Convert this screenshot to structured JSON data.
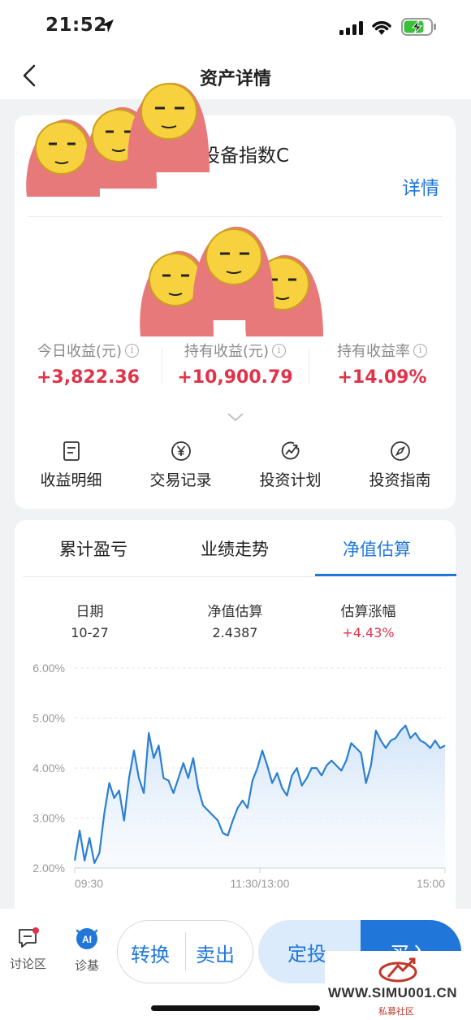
{
  "status_bar": {
    "time": "21:52"
  },
  "nav": {
    "title": "资产详情"
  },
  "fund": {
    "name_visible": "设备指数C",
    "detail_link": "详情"
  },
  "stats": [
    {
      "label": "今日收益(元)",
      "value": "+3,822.36"
    },
    {
      "label": "持有收益(元)",
      "value": "+10,900.79"
    },
    {
      "label": "持有收益率",
      "value": "+14.09%"
    }
  ],
  "actions": [
    {
      "label": "收益明细",
      "icon": "document-icon"
    },
    {
      "label": "交易记录",
      "icon": "yen-circle-icon"
    },
    {
      "label": "投资计划",
      "icon": "trend-circle-icon"
    },
    {
      "label": "投资指南",
      "icon": "compass-icon"
    }
  ],
  "tabs": [
    {
      "label": "累计盈亏"
    },
    {
      "label": "业绩走势"
    },
    {
      "label": "净值估算",
      "active": true
    }
  ],
  "info": {
    "date_label": "日期",
    "date_value": "10-27",
    "nav_label": "净值估算",
    "nav_value": "2.4387",
    "change_label": "估算涨幅",
    "change_value": "+4.43%"
  },
  "chart_data": {
    "type": "area",
    "y_ticks": [
      "6.00%",
      "5.00%",
      "4.00%",
      "3.00%",
      "2.00%"
    ],
    "x_ticks": [
      "09:30",
      "11:30/13:00",
      "15:00"
    ],
    "ylim": [
      2.0,
      6.0
    ],
    "values": [
      2.15,
      2.75,
      2.15,
      2.6,
      2.1,
      2.3,
      3.1,
      3.7,
      3.4,
      3.55,
      2.95,
      3.8,
      4.35,
      3.8,
      3.5,
      4.7,
      4.2,
      4.45,
      3.8,
      3.75,
      3.5,
      3.8,
      4.1,
      3.8,
      4.2,
      3.6,
      3.25,
      3.15,
      3.05,
      2.95,
      2.7,
      2.65,
      2.95,
      3.2,
      3.35,
      3.2,
      3.75,
      4.0,
      4.35,
      4.05,
      3.7,
      3.9,
      3.6,
      3.45,
      3.85,
      4.0,
      3.65,
      3.8,
      4.0,
      4.0,
      3.85,
      4.05,
      4.15,
      4.05,
      3.95,
      4.15,
      4.5,
      4.4,
      4.3,
      3.7,
      4.05,
      4.75,
      4.55,
      4.4,
      4.55,
      4.6,
      4.75,
      4.85,
      4.6,
      4.7,
      4.55,
      4.5,
      4.4,
      4.55,
      4.4,
      4.45
    ],
    "grid": true,
    "line_color": "#2a7fd4"
  },
  "bottom_bar": {
    "discuss_label": "讨论区",
    "diagnose_label": "诊基",
    "convert": "转换",
    "sell": "卖出",
    "auto_invest": "定投",
    "buy": "买入"
  },
  "watermark": {
    "site": "WWW.SIMU001.CN",
    "sub": "私募社区"
  }
}
